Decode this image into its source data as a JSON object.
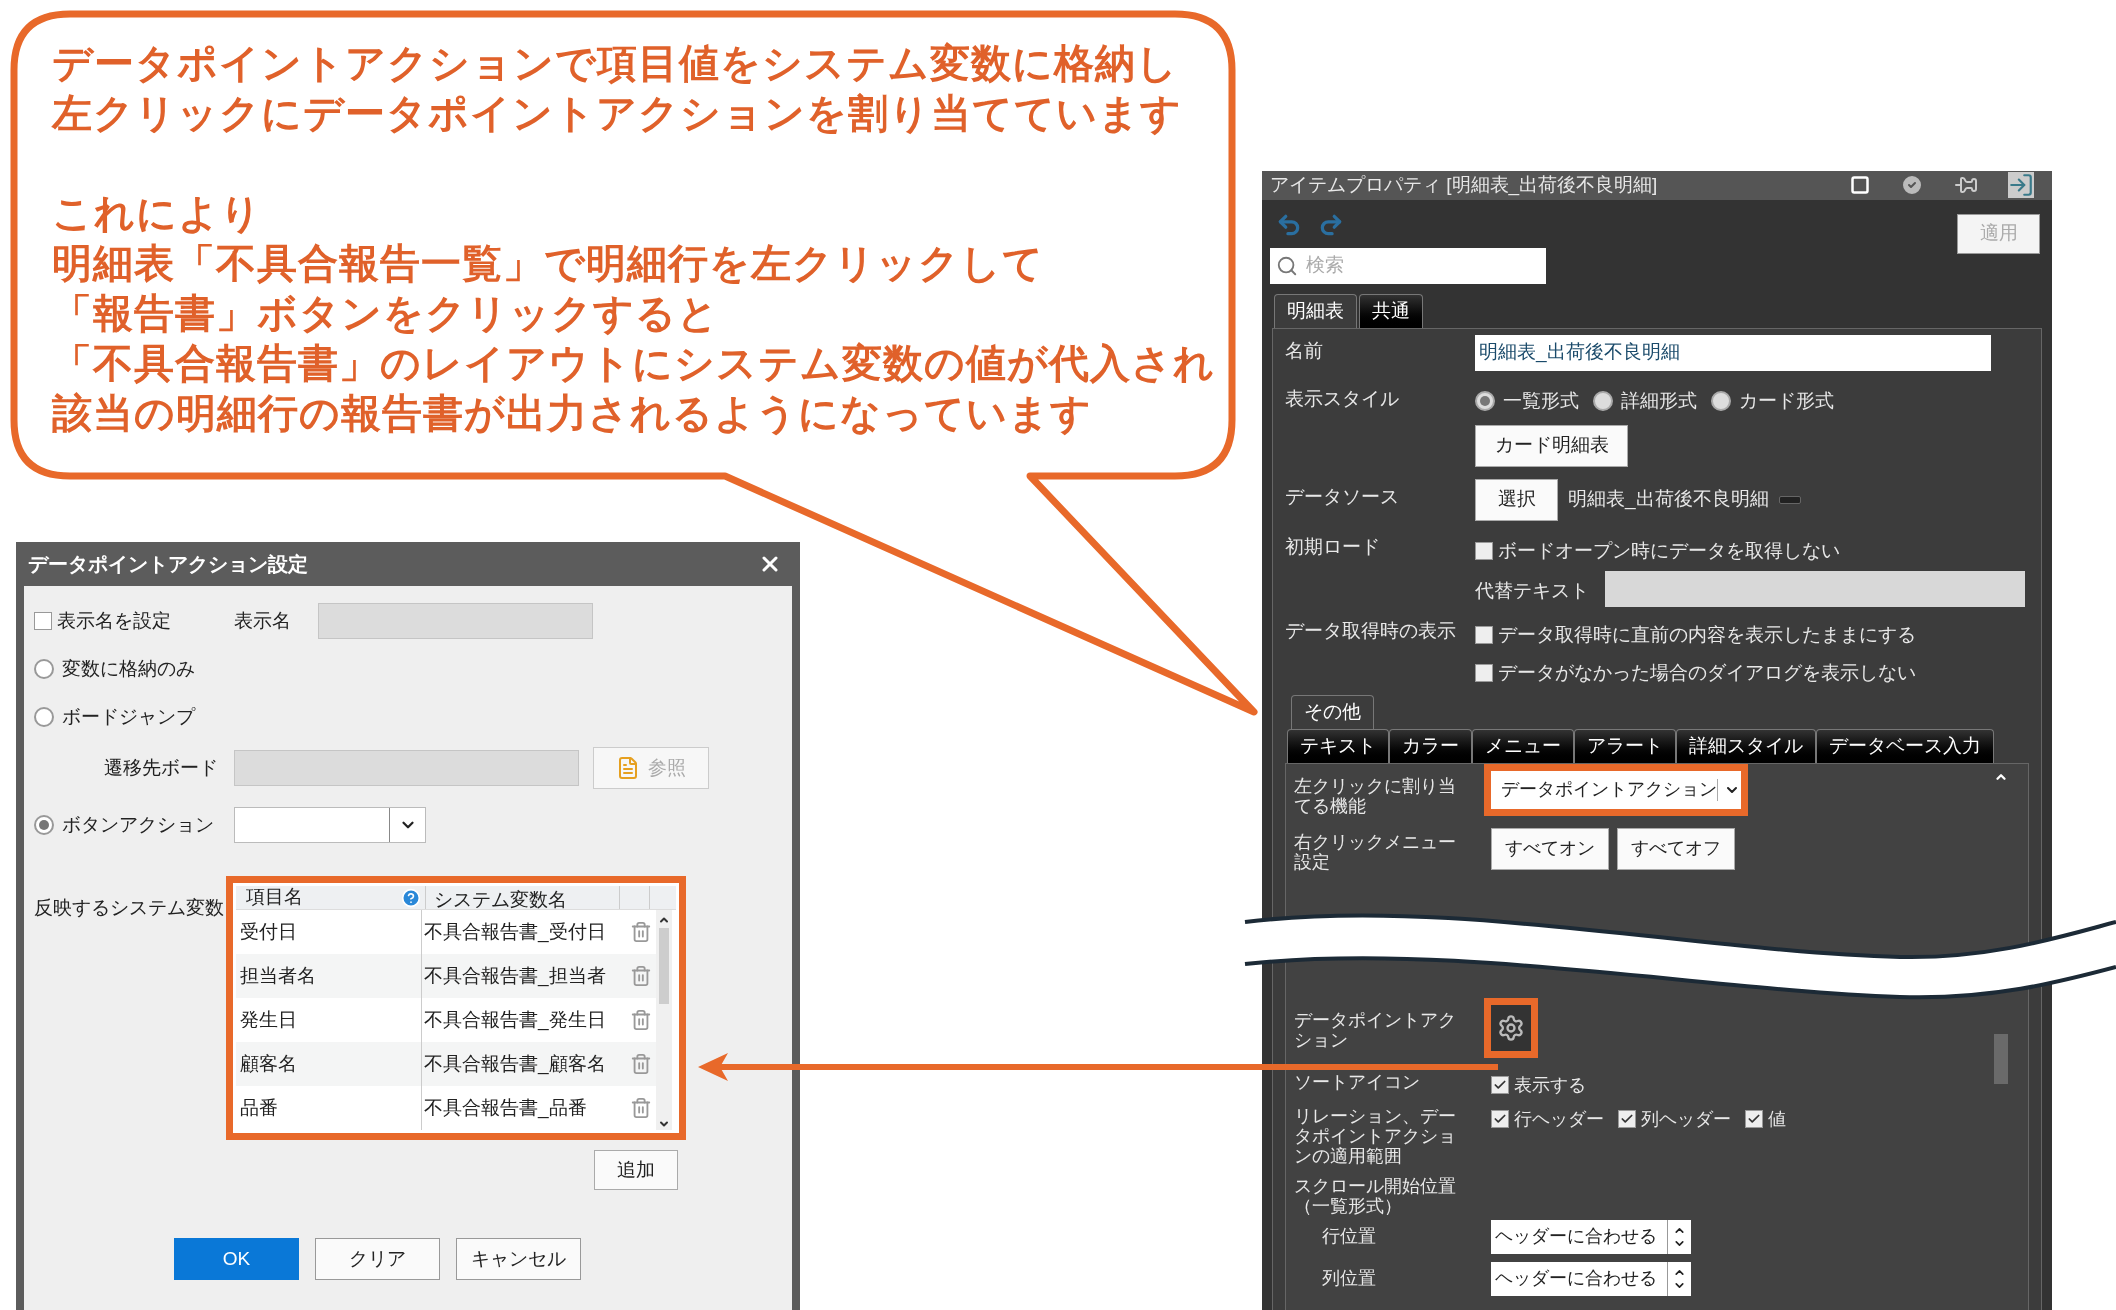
{
  "callout": {
    "paragraphs": [
      [
        "データポイントアクションで項目値をシステム変数に格納し",
        "左クリックにデータポイントアクションを割り当てています"
      ],
      [
        "これにより",
        "明細表「不具合報告一覧」で明細行を左クリックして",
        "「報告書」ボタンをクリックすると",
        "「不具合報告書」のレイアウトにシステム変数の値が代入され",
        "該当の明細行の報告書が出力されるようになっています"
      ]
    ]
  },
  "dialog": {
    "title": "データポイントアクション設定",
    "display_name_checkbox": {
      "label": "表示名を設定",
      "checked": false
    },
    "display_name_label": "表示名",
    "modes": [
      {
        "label": "変数に格納のみ",
        "selected": false
      },
      {
        "label": "ボードジャンプ",
        "selected": false
      },
      {
        "label": "ボタンアクション",
        "selected": true
      }
    ],
    "target_board_label": "遷移先ボード",
    "browse_button": {
      "label": "参照",
      "disabled": true
    },
    "system_vars_label": "反映するシステム変数",
    "columns": [
      "項目名",
      "システム変数名"
    ],
    "rows": [
      {
        "item": "受付日",
        "variable": "不具合報告書_受付日"
      },
      {
        "item": "担当者名",
        "variable": "不具合報告書_担当者"
      },
      {
        "item": "発生日",
        "variable": "不具合報告書_発生日"
      },
      {
        "item": "顧客名",
        "variable": "不具合報告書_顧客名"
      },
      {
        "item": "品番",
        "variable": "不具合報告書_品番"
      }
    ],
    "add_button": "追加",
    "buttons": [
      {
        "label": "OK",
        "kind": "primary"
      },
      {
        "label": "クリア",
        "kind": "normal"
      },
      {
        "label": "キャンセル",
        "kind": "normal"
      }
    ]
  },
  "properties": {
    "title": "アイテムプロパティ [明細表_出荷後不良明細]",
    "apply_button": "適用",
    "search": {
      "placeholder": "検索"
    },
    "tabs": [
      {
        "label": "明細表",
        "selected": true
      },
      {
        "label": "共通",
        "selected": false
      }
    ],
    "name_label": "名前",
    "name_value": "明細表_出荷後不良明細",
    "style_label": "表示スタイル",
    "styles": [
      {
        "label": "一覧形式",
        "selected": true
      },
      {
        "label": "詳細形式",
        "selected": false
      },
      {
        "label": "カード形式",
        "selected": false
      }
    ],
    "card_button": "カード明細表",
    "datasource_label": "データソース",
    "select_button": "選択",
    "datasource_value": "明細表_出荷後不良明細",
    "initial_load_label": "初期ロード",
    "initial_load_checkbox": {
      "label": "ボードオープン時にデータを取得しない",
      "checked": false
    },
    "alt_text_label": "代替テキスト",
    "fetch_label": "データ取得時の表示",
    "fetch_checkboxes": [
      {
        "label": "データ取得時に直前の内容を表示したままにする",
        "checked": false
      },
      {
        "label": "データがなかった場合のダイアログを表示しない",
        "checked": false
      }
    ],
    "subtabs_back": [
      {
        "label": "その他",
        "selected": true
      }
    ],
    "subtabs_front": [
      {
        "label": "テキスト",
        "selected": false
      },
      {
        "label": "カラー",
        "selected": false
      },
      {
        "label": "メニュー",
        "selected": false
      },
      {
        "label": "アラート",
        "selected": false
      },
      {
        "label": "詳細スタイル",
        "selected": false
      },
      {
        "label": "データベース入力",
        "selected": false
      }
    ],
    "left_click_label": "左クリックに割り当てる機能",
    "left_click_value": "データポイントアクション",
    "right_click_label": "右クリックメニュー設定",
    "all_on_button": "すべてオン",
    "all_off_button": "すべてオフ",
    "dpa_label": "データポイントアクション",
    "sort_label": "ソートアイコン",
    "sort_checkbox": {
      "label": "表示する",
      "checked": true
    },
    "scope_label": "リレーション、データポイントアクションの適用範囲",
    "scope_checkboxes": [
      {
        "label": "行ヘッダー",
        "checked": true
      },
      {
        "label": "列ヘッダー",
        "checked": true
      },
      {
        "label": "値",
        "checked": true
      }
    ],
    "scroll_label": "スクロール開始位置（一覧形式）",
    "positions": [
      {
        "label": "行位置",
        "value": "ヘッダーに合わせる"
      },
      {
        "label": "列位置",
        "value": "ヘッダーに合わせる"
      }
    ]
  }
}
